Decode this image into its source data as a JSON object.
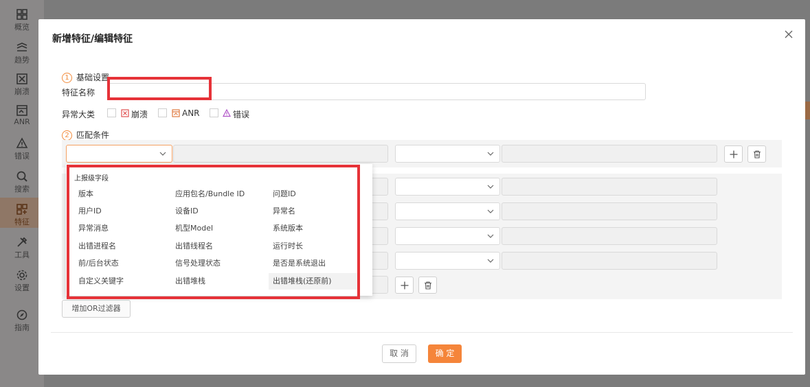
{
  "sidebar": {
    "items": [
      {
        "label": "概览",
        "icon": "dashboard-icon"
      },
      {
        "label": "趋势",
        "icon": "trend-icon"
      },
      {
        "label": "崩溃",
        "icon": "crash-icon"
      },
      {
        "label": "ANR",
        "icon": "anr-icon"
      },
      {
        "label": "错误",
        "icon": "error-icon"
      },
      {
        "label": "搜索",
        "icon": "search-icon"
      },
      {
        "label": "特征",
        "icon": "feature-icon",
        "active": true
      },
      {
        "label": "工具",
        "icon": "tools-icon"
      },
      {
        "label": "设置",
        "icon": "gear-icon"
      },
      {
        "label": "指南",
        "icon": "guide-icon"
      }
    ]
  },
  "modal": {
    "title": "新增特征/编辑特征",
    "step1": {
      "num": "1",
      "label": "基础设置"
    },
    "name_label": "特征名称",
    "name_value": "",
    "category_label": "异常大类",
    "categories": [
      {
        "label": "崩溃",
        "checked": false,
        "icon": "crash-icon"
      },
      {
        "label": "ANR",
        "checked": false,
        "icon": "anr-icon"
      },
      {
        "label": "错误",
        "checked": false,
        "icon": "warning-icon"
      }
    ],
    "step2": {
      "num": "2",
      "label": "匹配条件"
    },
    "add_or_filter": "增加OR过滤器",
    "cancel": "取 消",
    "ok": "确 定"
  },
  "dropdown": {
    "header": "上报级字段",
    "items": [
      [
        "版本",
        "应用包名/Bundle ID",
        "问题ID"
      ],
      [
        "用户ID",
        "设备ID",
        "异常名"
      ],
      [
        "异常消息",
        "机型Model",
        "系统版本"
      ],
      [
        "出错进程名",
        "出错线程名",
        "运行时长"
      ],
      [
        "前/后台状态",
        "信号处理状态",
        "是否是系统退出"
      ],
      [
        "自定义关键字",
        "出错堆栈",
        "出错堆栈(还原前)"
      ]
    ]
  },
  "colors": {
    "accent": "#f5853a",
    "annotation": "#e63238"
  }
}
